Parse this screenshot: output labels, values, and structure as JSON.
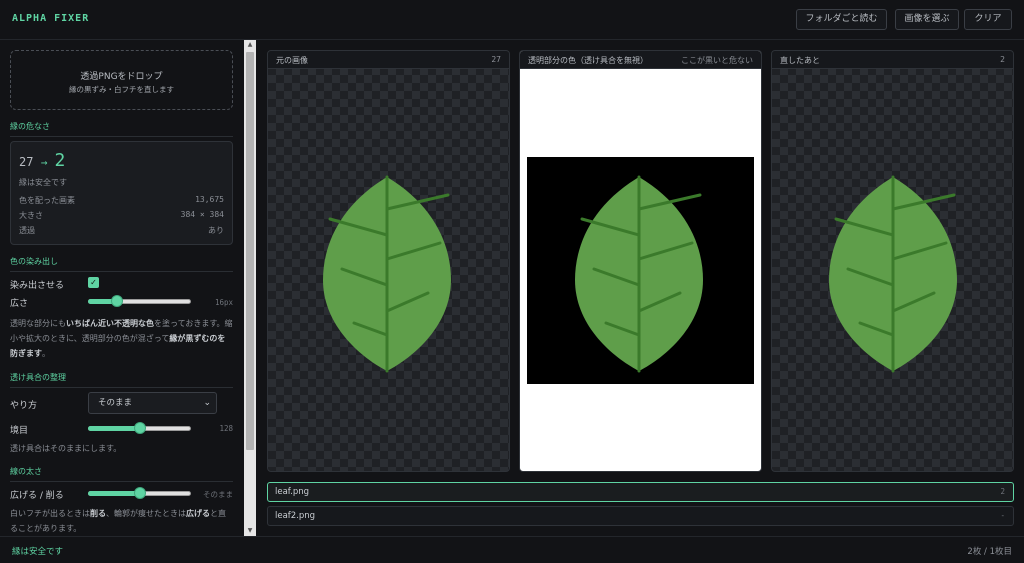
{
  "header": {
    "title": "ALPHA FIXER",
    "buttons": [
      "フォルダごと読む",
      "画像を選ぶ",
      "クリア"
    ]
  },
  "dropzone": {
    "title": "透過PNGをドロップ",
    "subtitle": "縁の黒ずみ・白フチを直します"
  },
  "danger": {
    "heading": "縁の危なさ",
    "before": "27",
    "arrow": "→",
    "after": "2",
    "status": "縁は安全です",
    "rows": [
      {
        "label": "色を配った画素",
        "value": "13,675"
      },
      {
        "label": "大きさ",
        "value": "384 × 384"
      },
      {
        "label": "透過",
        "value": "あり"
      }
    ]
  },
  "bleed": {
    "heading": "色の染み出し",
    "checkbox_label": "染み出させる",
    "checked": true,
    "width_label": "広さ",
    "width_value": "16px",
    "width_level": 0.28,
    "desc_plain_1": "透明な部分にも",
    "desc_bold_1": "いちばん近い不透明な色",
    "desc_plain_2": "を塗っておきます。縮小や拡大のときに、透明部分の色が混ざって",
    "desc_bold_2": "縁が黒ずむのを防ぎます",
    "desc_plain_3": "。"
  },
  "alpha": {
    "heading": "透け具合の整理",
    "method_label": "やり方",
    "method_value": "そのまま",
    "threshold_label": "境目",
    "threshold_value": "128",
    "threshold_level": 0.5,
    "desc": "透け具合はそのままにします。"
  },
  "edge": {
    "heading": "線の太さ",
    "label": "広げる / 削る",
    "value": "そのまま",
    "level": 0.5,
    "desc_plain_1": "白いフチが出るときは",
    "desc_bold_1": "削る",
    "desc_plain_2": "、輪郭が痩せたときは",
    "desc_bold_2": "広げる",
    "desc_plain_3": "と直ることがあります。"
  },
  "panels": [
    {
      "title": "元の画像",
      "badge": "27"
    },
    {
      "title": "透明部分の色（透け具合を無視）",
      "badge": "ここが黒いと危ない"
    },
    {
      "title": "直したあと",
      "badge": "2"
    }
  ],
  "files": [
    {
      "name": "leaf.png",
      "value": "2"
    },
    {
      "name": "leaf2.png",
      "value": "-"
    }
  ],
  "footer": {
    "status": "縁は安全です",
    "count": "2枚 / 1枚目"
  },
  "colors": {
    "accent": "#5fd4a3",
    "leaf": "#5f9e4a",
    "vein": "#3b7a2b"
  }
}
